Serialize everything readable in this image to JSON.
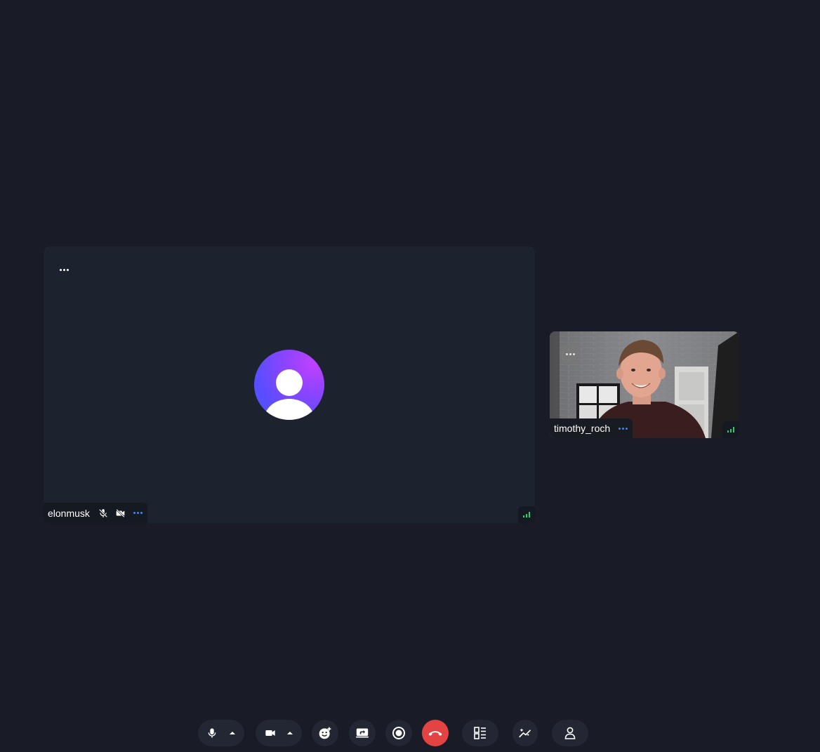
{
  "participants": [
    {
      "name": "elonmusk",
      "mic": "muted",
      "camera": "off"
    },
    {
      "name": "timothy_roch"
    }
  ],
  "colors": {
    "background": "#191b26",
    "tile": "#1c232e",
    "accent_blue": "#2f8cff",
    "signal_green": "#2ecc71",
    "end_call_red": "#e34343"
  },
  "toolbar": {
    "buttons": [
      {
        "icon": "mic-icon",
        "has_dropdown": true
      },
      {
        "icon": "camera-icon",
        "has_dropdown": true
      },
      {
        "icon": "emoji-reaction-icon"
      },
      {
        "icon": "screen-share-icon"
      },
      {
        "icon": "record-icon"
      },
      {
        "icon": "end-call-icon"
      },
      {
        "icon": "layout-icon"
      },
      {
        "icon": "effects-icon"
      },
      {
        "icon": "participants-icon"
      }
    ]
  }
}
